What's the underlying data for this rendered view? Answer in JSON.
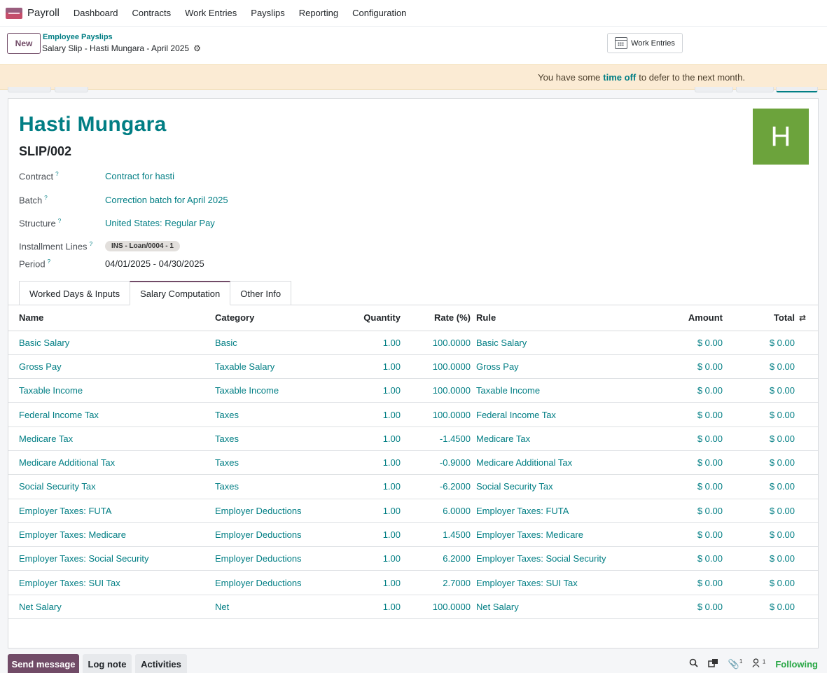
{
  "navbar": {
    "app_name": "Payroll",
    "menu": [
      "Dashboard",
      "Contracts",
      "Work Entries",
      "Payslips",
      "Reporting",
      "Configuration"
    ]
  },
  "control_panel": {
    "new_label": "New",
    "breadcrumb_parent": "Employee Payslips",
    "breadcrumb_current": "Salary Slip - Hasti Mungara - April 2025",
    "work_entries_label": "Work Entries"
  },
  "banner": {
    "before": "You have some",
    "link": "time off",
    "after": "to defer to the next month."
  },
  "form": {
    "employee_name": "Hasti Mungara",
    "reference": "SLIP/002",
    "avatar_letter": "H",
    "avatar_color": "#6ca33c",
    "fields": {
      "contract_label": "Contract",
      "contract_value": "Contract for hasti",
      "batch_label": "Batch",
      "batch_value": "Correction batch for April 2025",
      "structure_label": "Structure",
      "structure_value": "United States: Regular Pay",
      "installment_label": "Installment Lines",
      "installment_tag": "INS - Loan/0004 - 1",
      "period_label": "Period",
      "period_value": "04/01/2025 - 04/30/2025"
    },
    "help_mark": "?"
  },
  "tabs": [
    "Worked Days & Inputs",
    "Salary Computation",
    "Other Info"
  ],
  "table": {
    "headers": {
      "name": "Name",
      "category": "Category",
      "quantity": "Quantity",
      "rate": "Rate (%)",
      "rule": "Rule",
      "amount": "Amount",
      "total": "Total"
    },
    "rows": [
      {
        "name": "Basic Salary",
        "category": "Basic",
        "quantity": "1.00",
        "rate": "100.0000",
        "rule": "Basic Salary",
        "amount": "$ 0.00",
        "total": "$ 0.00"
      },
      {
        "name": "Gross Pay",
        "category": "Taxable Salary",
        "quantity": "1.00",
        "rate": "100.0000",
        "rule": "Gross Pay",
        "amount": "$ 0.00",
        "total": "$ 0.00"
      },
      {
        "name": "Taxable Income",
        "category": "Taxable Income",
        "quantity": "1.00",
        "rate": "100.0000",
        "rule": "Taxable Income",
        "amount": "$ 0.00",
        "total": "$ 0.00"
      },
      {
        "name": "Federal Income Tax",
        "category": "Taxes",
        "quantity": "1.00",
        "rate": "100.0000",
        "rule": "Federal Income Tax",
        "amount": "$ 0.00",
        "total": "$ 0.00"
      },
      {
        "name": "Medicare Tax",
        "category": "Taxes",
        "quantity": "1.00",
        "rate": "-1.4500",
        "rule": "Medicare Tax",
        "amount": "$ 0.00",
        "total": "$ 0.00"
      },
      {
        "name": "Medicare Additional Tax",
        "category": "Taxes",
        "quantity": "1.00",
        "rate": "-0.9000",
        "rule": "Medicare Additional Tax",
        "amount": "$ 0.00",
        "total": "$ 0.00"
      },
      {
        "name": "Social Security Tax",
        "category": "Taxes",
        "quantity": "1.00",
        "rate": "-6.2000",
        "rule": "Social Security Tax",
        "amount": "$ 0.00",
        "total": "$ 0.00"
      },
      {
        "name": "Employer Taxes: FUTA",
        "category": "Employer Deductions",
        "quantity": "1.00",
        "rate": "6.0000",
        "rule": "Employer Taxes: FUTA",
        "amount": "$ 0.00",
        "total": "$ 0.00"
      },
      {
        "name": "Employer Taxes: Medicare",
        "category": "Employer Deductions",
        "quantity": "1.00",
        "rate": "1.4500",
        "rule": "Employer Taxes: Medicare",
        "amount": "$ 0.00",
        "total": "$ 0.00"
      },
      {
        "name": "Employer Taxes: Social Security",
        "category": "Employer Deductions",
        "quantity": "1.00",
        "rate": "6.2000",
        "rule": "Employer Taxes: Social Security",
        "amount": "$ 0.00",
        "total": "$ 0.00"
      },
      {
        "name": "Employer Taxes: SUI Tax",
        "category": "Employer Deductions",
        "quantity": "1.00",
        "rate": "2.7000",
        "rule": "Employer Taxes: SUI Tax",
        "amount": "$ 0.00",
        "total": "$ 0.00"
      },
      {
        "name": "Net Salary",
        "category": "Net",
        "quantity": "1.00",
        "rate": "100.0000",
        "rule": "Net Salary",
        "amount": "$ 0.00",
        "total": "$ 0.00"
      }
    ]
  },
  "chatter": {
    "send_message": "Send message",
    "log_note": "Log note",
    "activities": "Activities",
    "attachments_count": "1",
    "followers_count": "1",
    "following_label": "Following"
  },
  "colors": {
    "brand": "#714b67",
    "link": "#017e84",
    "following": "#28a745"
  }
}
